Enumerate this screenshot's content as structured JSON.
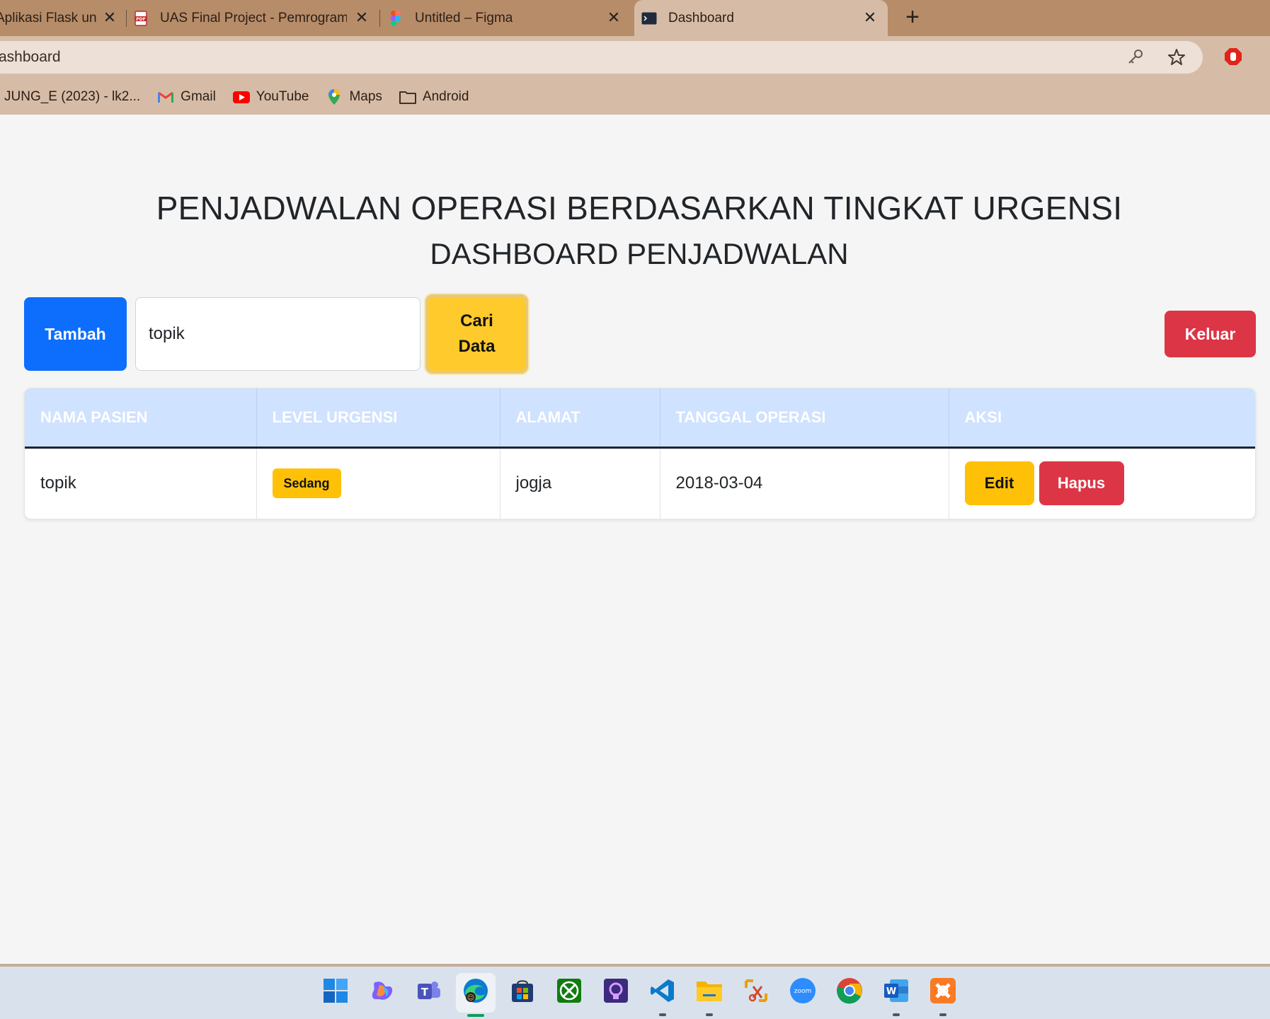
{
  "browser": {
    "tabs": [
      {
        "title": "Aplikasi Flask untuk",
        "icon": "partial-icon"
      },
      {
        "title": "UAS Final Project - Pemrograman",
        "icon": "pdf-icon"
      },
      {
        "title": "Untitled – Figma",
        "icon": "figma-icon"
      },
      {
        "title": "Dashboard",
        "icon": "terminal-icon",
        "active": true
      }
    ],
    "new_tab": "+",
    "close_glyph": "✕",
    "url": "ashboard",
    "bookmarks": [
      {
        "label": "JUNG_E (2023) - lk2...",
        "icon": "movie-icon"
      },
      {
        "label": "Gmail",
        "icon": "gmail-icon"
      },
      {
        "label": "YouTube",
        "icon": "youtube-icon"
      },
      {
        "label": "Maps",
        "icon": "maps-icon"
      },
      {
        "label": "Android",
        "icon": "folder-icon"
      }
    ]
  },
  "page": {
    "title": "PENJADWALAN OPERASI BERDASARKAN TINGKAT URGENSI",
    "subtitle": "DASHBOARD PENJADWALAN",
    "add_label": "Tambah",
    "search_value": "topik",
    "search_btn_line1": "Cari",
    "search_btn_line2": "Data",
    "logout_label": "Keluar",
    "table": {
      "headers": [
        "NAMA PASIEN",
        "LEVEL URGENSI",
        "ALAMAT",
        "TANGGAL OPERASI",
        "AKSI"
      ],
      "rows": [
        {
          "nama": "topik",
          "level": "Sedang",
          "alamat": "jogja",
          "tanggal": "2018-03-04",
          "edit": "Edit",
          "hapus": "Hapus"
        }
      ]
    }
  },
  "colors": {
    "primary": "#0d6efd",
    "warning": "#ffc107",
    "danger": "#dc3545",
    "table_header": "#cfe2ff"
  },
  "taskbar": {
    "apps": [
      "windows-start-icon",
      "copilot-icon",
      "teams-icon",
      "edge-icon",
      "store-icon",
      "xbox-icon",
      "proton-vpn-icon",
      "vscode-icon",
      "file-explorer-icon",
      "snipping-icon",
      "zoom-icon",
      "chrome-icon",
      "word-icon",
      "xampp-icon"
    ],
    "zoom_text": "zoom",
    "word_text": "W"
  }
}
